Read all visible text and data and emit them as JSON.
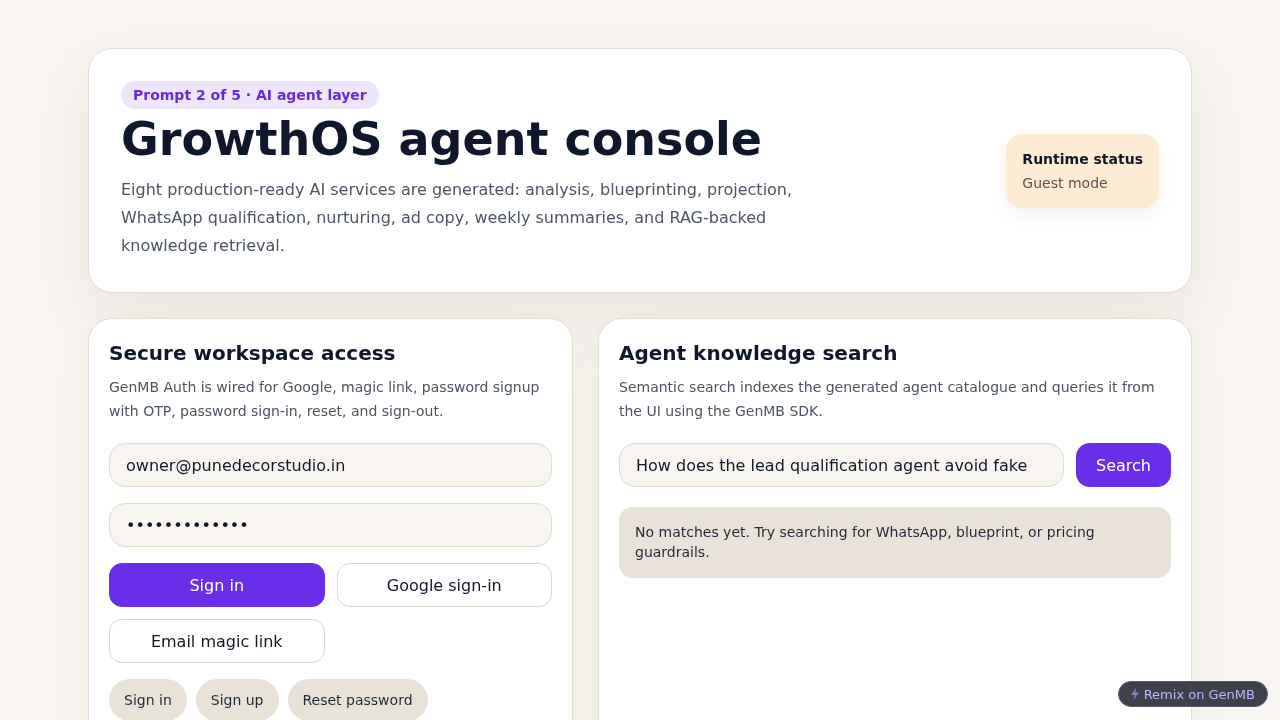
{
  "hero": {
    "badge": "Prompt 2 of 5 · AI agent layer",
    "title": "GrowthOS agent console",
    "description": "Eight production-ready AI services are generated: analysis, blueprinting, projection, WhatsApp qualification, nurturing, ad copy, weekly summaries, and RAG-backed knowledge retrieval.",
    "status": {
      "title": "Runtime status",
      "value": "Guest mode"
    }
  },
  "auth": {
    "title": "Secure workspace access",
    "description": "GenMB Auth is wired for Google, magic link, password signup with OTP, password sign-in, reset, and sign-out.",
    "fields": [
      {
        "value": "owner@punedecorstudio.in"
      },
      {
        "value": "•••••••••••••"
      }
    ],
    "actions": [
      {
        "label": "Sign in",
        "kind": "primary"
      },
      {
        "label": "Google sign-in",
        "kind": "outline"
      },
      {
        "label": "Email magic link",
        "kind": "outline"
      }
    ],
    "modes": [
      {
        "label": "Sign in"
      },
      {
        "label": "Sign up"
      },
      {
        "label": "Reset password"
      }
    ]
  },
  "search": {
    "title": "Agent knowledge search",
    "description": "Semantic search indexes the generated agent catalogue and queries it from the UI using the GenMB SDK.",
    "query": {
      "value": "How does the lead qualification agent avoid fake"
    },
    "button": "Search",
    "result": "No matches yet. Try searching for WhatsApp, blueprint, or pricing guardrails."
  },
  "remix_badge": {
    "label": "Remix on GenMB"
  }
}
